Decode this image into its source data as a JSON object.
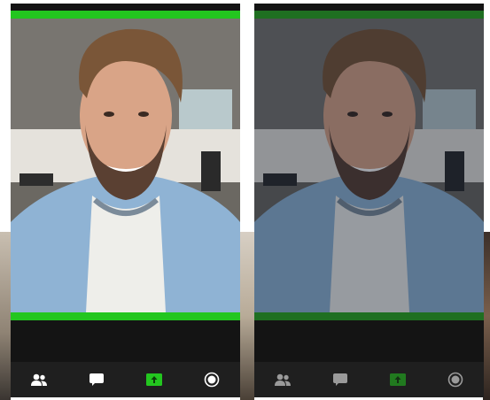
{
  "screens": [
    {
      "state": "active",
      "toolbar": {
        "items": [
          {
            "icon": "participants-icon",
            "color": "#ffffff"
          },
          {
            "icon": "chat-icon",
            "color": "#ffffff"
          },
          {
            "icon": "share-screen-icon",
            "color": "#23c61f"
          },
          {
            "icon": "record-icon",
            "color": "#ffffff"
          }
        ]
      },
      "colors": {
        "active_speaker_border": "#23c61f"
      }
    },
    {
      "state": "dimmed",
      "toolbar": {
        "items": [
          {
            "icon": "participants-icon",
            "color": "#9a9a9a"
          },
          {
            "icon": "chat-icon",
            "color": "#9a9a9a"
          },
          {
            "icon": "share-screen-icon",
            "color": "#1f8a22"
          },
          {
            "icon": "record-icon",
            "color": "#9a9a9a"
          }
        ]
      },
      "colors": {
        "active_speaker_border": "#1f6f21"
      }
    }
  ]
}
